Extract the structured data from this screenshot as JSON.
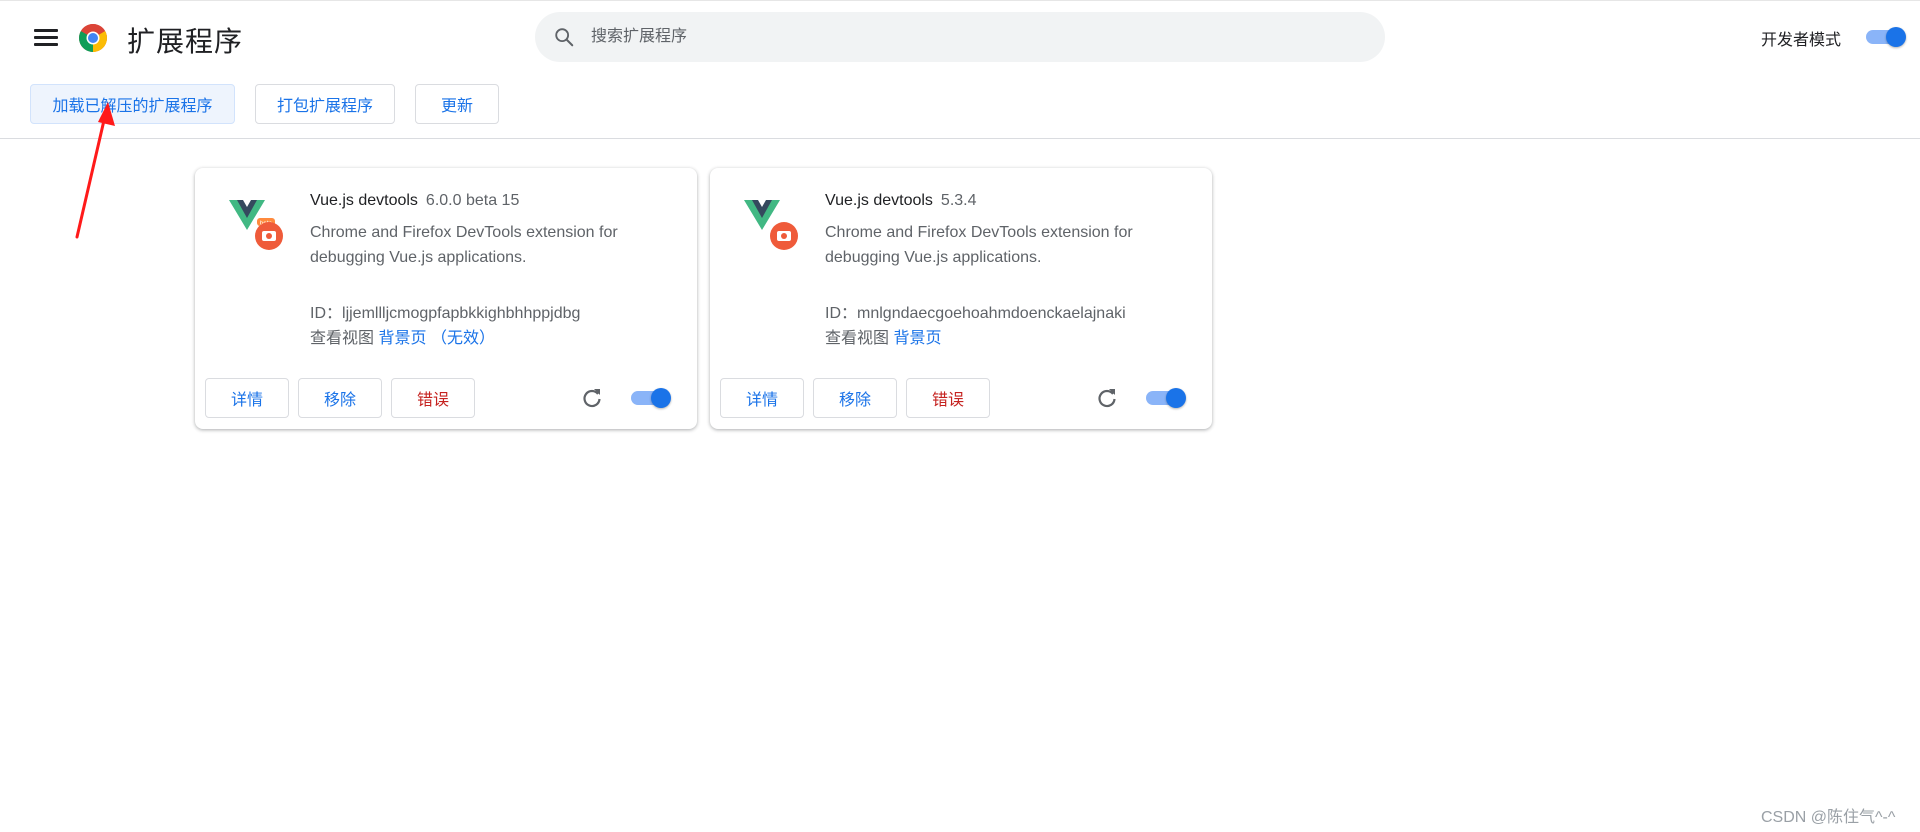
{
  "header": {
    "title": "扩展程序",
    "search_placeholder": "搜索扩展程序",
    "devmode_label": "开发者模式",
    "devmode_on": true
  },
  "toolbar": {
    "load_unpacked": "加载已解压的扩展程序",
    "pack": "打包扩展程序",
    "update": "更新"
  },
  "extensions": [
    {
      "name": "Vue.js devtools",
      "version": "6.0.0 beta 15",
      "description": "Chrome and Firefox DevTools extension for debugging Vue.js applications.",
      "id_label": "ID：",
      "id": "ljjemllljcmogpfapbkkighbhhppjdbg",
      "views_label": "查看视图",
      "background_link": "背景页",
      "inactive_link": "（无效）",
      "details_btn": "详情",
      "remove_btn": "移除",
      "errors_btn": "错误",
      "enabled": true,
      "beta_badge": true
    },
    {
      "name": "Vue.js devtools",
      "version": "5.3.4",
      "description": "Chrome and Firefox DevTools extension for debugging Vue.js applications.",
      "id_label": "ID：",
      "id": "mnlgndaecgoehoahmdoenckaelajnaki",
      "views_label": "查看视图",
      "background_link": "背景页",
      "details_btn": "详情",
      "remove_btn": "移除",
      "errors_btn": "错误",
      "enabled": true,
      "beta_badge": false
    }
  ],
  "watermark": "CSDN @陈住气^-^",
  "colors": {
    "accent": "#1a73e8",
    "error": "#c5221f",
    "annotation": "#ff1a1a"
  }
}
